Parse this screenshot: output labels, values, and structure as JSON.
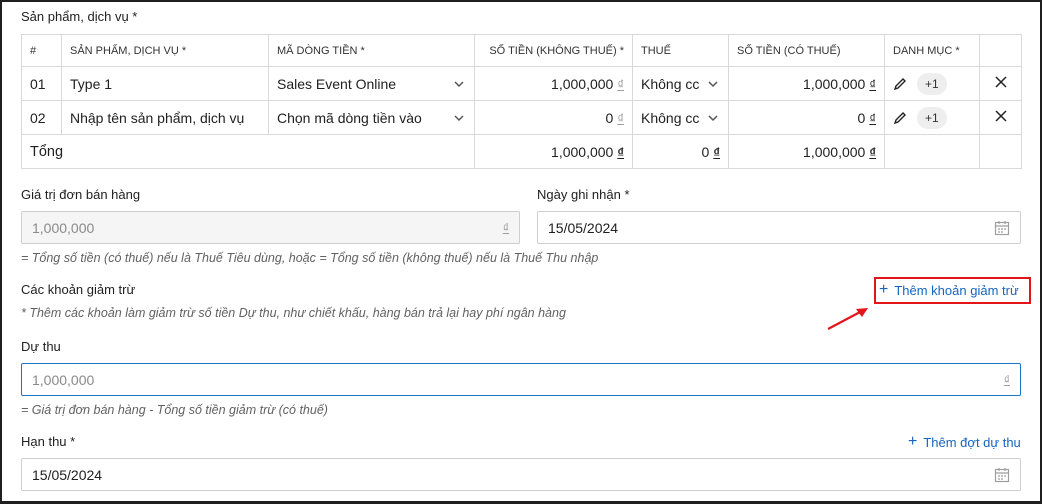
{
  "section_title": "Sản phẩm, dịch vụ *",
  "table": {
    "headers": [
      "#",
      "SẢN PHẨM, DỊCH VỤ *",
      "MÃ DÒNG TIỀN *",
      "SỐ TIỀN (KHÔNG THUẾ) *",
      "THUẾ",
      "SỐ TIỀN (CÓ THUẾ)",
      "DANH MỤC *"
    ],
    "rows": [
      {
        "index": "01",
        "product": "Type 1",
        "cashflow": "Sales Event Online",
        "amount": "1,000,000",
        "tax": "Không cc",
        "amount_tax": "1,000,000",
        "category_badge": "+1"
      },
      {
        "index": "02",
        "product_placeholder": "Nhập tên sản phẩm, dịch vụ",
        "cashflow_placeholder": "Chọn mã dòng tiền vào",
        "amount": "0",
        "tax": "Không cc",
        "amount_tax": "0",
        "category_badge": "+1"
      }
    ],
    "total": {
      "label": "Tổng",
      "amount": "1,000,000",
      "tax": "0",
      "amount_tax": "1,000,000"
    },
    "currency": "₫"
  },
  "sales_value": {
    "label": "Giá trị đơn bán hàng",
    "value": "1,000,000",
    "currency": "₫",
    "hint": "= Tổng số tiền (có thuế) nếu là Thuế Tiêu dùng, hoặc = Tổng số tiền (không thuế) nếu là Thuế Thu nhập"
  },
  "record_date": {
    "label": "Ngày ghi nhận *",
    "value": "15/05/2024"
  },
  "deductions": {
    "label": "Các khoản giảm trừ",
    "hint": "* Thêm các khoản làm giảm trừ số tiền Dự thu, như chiết khấu, hàng bán trả lại hay phí ngân hàng",
    "add_label": "Thêm khoản giảm trừ"
  },
  "expected": {
    "label": "Dự thu",
    "value": "1,000,000",
    "currency": "₫",
    "hint": "= Giá trị đơn bán hàng - Tổng số tiền giảm trừ (có thuế)"
  },
  "due_date": {
    "label": "Hạn thu *",
    "value": "15/05/2024",
    "add_label": "Thêm đợt dự thu"
  },
  "colors": {
    "accent": "#1565c0",
    "highlight": "#e4141b"
  }
}
